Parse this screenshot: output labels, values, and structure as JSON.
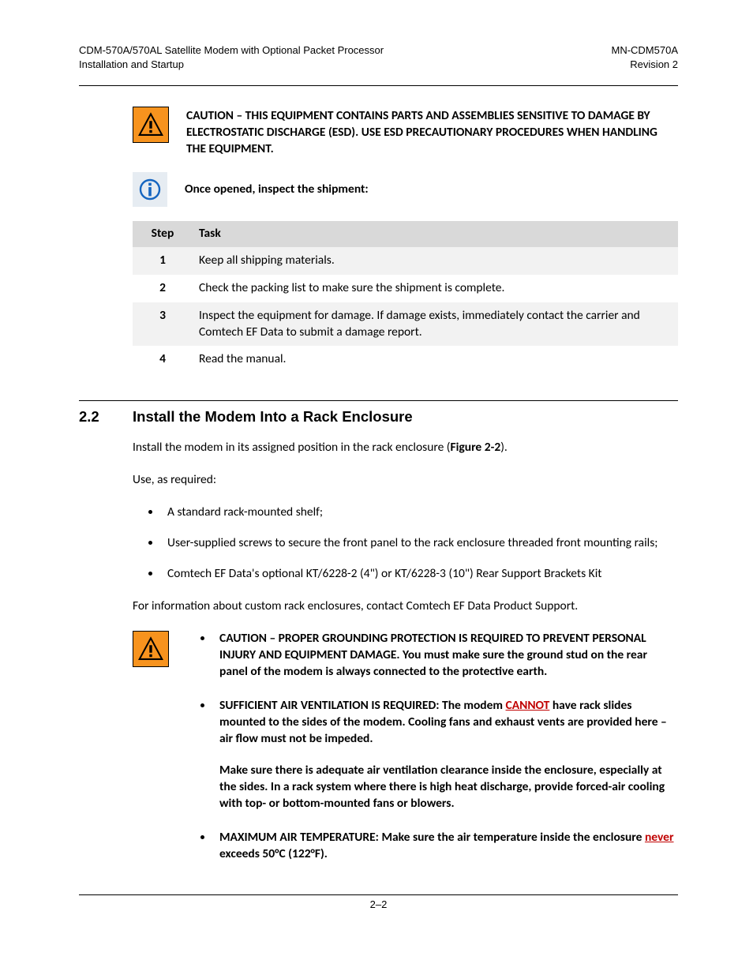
{
  "header": {
    "left_line1": "CDM-570A/570AL Satellite Modem with Optional Packet Processor",
    "left_line2": "Installation and Startup",
    "right_line1": "MN-CDM570A",
    "right_line2": "Revision 2"
  },
  "caution1": "CAUTION – THIS EQUIPMENT CONTAINS PARTS AND ASSEMBLIES SENSITIVE TO DAMAGE BY ELECTROSTATIC DISCHARGE (ESD). USE ESD PRECAUTIONARY PROCEDURES WHEN HANDLING THE EQUIPMENT.",
  "inspect_intro": "Once opened, inspect the shipment:",
  "steps_table": {
    "headers": {
      "step": "Step",
      "task": "Task"
    },
    "rows": [
      {
        "step": "1",
        "task": "Keep all shipping materials."
      },
      {
        "step": "2",
        "task": "Check the packing list to make sure the shipment is complete."
      },
      {
        "step": "3",
        "task": "Inspect the equipment for damage. If damage exists, immediately contact the carrier and Comtech EF Data to submit a damage report."
      },
      {
        "step": "4",
        "task": "Read the manual."
      }
    ]
  },
  "section": {
    "number": "2.2",
    "title": "Install the Modem Into a Rack Enclosure",
    "intro_pre": "Install the modem in its assigned position in the rack enclosure (",
    "intro_bold": "Figure 2-2",
    "intro_post": ").",
    "use_required": "Use, as required:",
    "bullets": [
      "A standard rack-mounted shelf;",
      "User-supplied screws to secure the front panel to the rack enclosure threaded front mounting rails;",
      "Comtech EF Data's optional KT/6228-2 (4\") or KT/6228-3 (10\") Rear Support Brackets Kit"
    ],
    "custom_info": "For information about custom rack enclosures, contact Comtech EF Data Product Support."
  },
  "caution_list": {
    "item1": "CAUTION – PROPER GROUNDING PROTECTION IS REQUIRED TO PREVENT PERSONAL INJURY AND EQUIPMENT DAMAGE. You must make sure the ground stud on the rear panel of the modem is always connected to the protective earth.",
    "item2_pre": "SUFFICIENT AIR VENTILATION IS REQUIRED: The modem ",
    "item2_emph": "CANNOT",
    "item2_post": " have rack slides mounted to the sides of the modem. Cooling fans and exhaust vents are provided here – air flow must not be impeded.",
    "item2_para2": "Make sure there is adequate air ventilation clearance inside the enclosure, especially at the sides. In a rack system where there is high heat discharge, provide forced-air cooling with top- or bottom-mounted fans or blowers.",
    "item3_pre": "MAXIMUM AIR TEMPERATURE: Make sure the air temperature inside the enclosure ",
    "item3_emph": "never",
    "item3_post": " exceeds 50°C (122°F)."
  },
  "footer": "2–2"
}
